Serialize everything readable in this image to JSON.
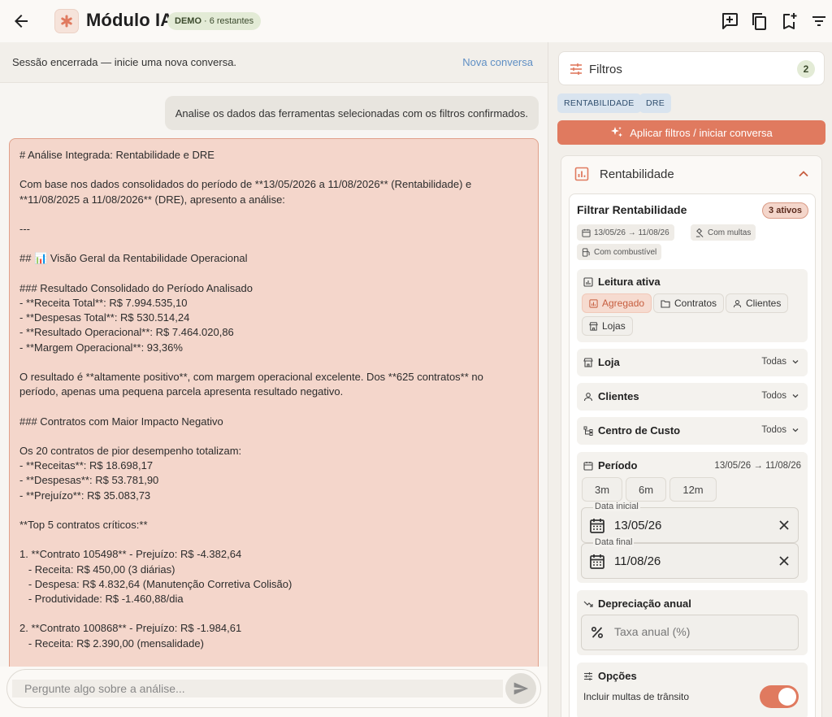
{
  "header": {
    "title": "Módulo IA",
    "badge_demo": "DEMO",
    "badge_rest": "· 6 restantes",
    "icons": [
      "back-arrow-icon",
      "asterisk-logo-icon",
      "add-comment-icon",
      "copy-icon",
      "bookmark-add-icon",
      "filter-list-icon"
    ]
  },
  "session": {
    "text": "Sessão encerrada — inicie uma nova conversa.",
    "new_conversation": "Nova conversa"
  },
  "chat": {
    "user_message": "Analise os dados das ferramentas selecionadas com os filtros confirmados.",
    "ai_lines": [
      "# Análise Integrada: Rentabilidade e DRE",
      "",
      "Com base nos dados consolidados do período de **13/05/2026 a 11/08/2026** (Rentabilidade) e",
      "**11/08/2025 a 11/08/2026** (DRE), apresento a análise:",
      "",
      "---",
      "",
      "## 📊 Visão Geral da Rentabilidade Operacional",
      "",
      "### Resultado Consolidado do Período Analisado",
      "- **Receita Total**: R$ 7.994.535,10",
      "- **Despesas Total**: R$ 530.514,24",
      "- **Resultado Operacional**: R$ 7.464.020,86",
      "- **Margem Operacional**: 93,36%",
      "",
      "O resultado é **altamente positivo**, com margem operacional excelente. Dos **625 contratos** no",
      "período, apenas uma pequena parcela apresenta resultado negativo.",
      "",
      "### Contratos com Maior Impacto Negativo",
      "",
      "Os 20 contratos de pior desempenho totalizam:",
      "- **Receitas**: R$ 18.698,17",
      "- **Despesas**: R$ 53.781,90",
      "- **Prejuízo**: R$ 35.083,73",
      "",
      "**Top 5 contratos críticos:**",
      "",
      "1. **Contrato 105498** - Prejuízo: R$ -4.382,64",
      "   - Receita: R$ 450,00 (3 diárias)",
      "   - Despesa: R$ 4.832,64 (Manutenção Corretiva Colisão)",
      "   - Produtividade: R$ -1.460,88/dia",
      "",
      "2. **Contrato 100868** - Prejuízo: R$ -1.984,61",
      "   - Receita: R$ 2.390,00 (mensalidade)"
    ]
  },
  "composer": {
    "placeholder": "Pergunte algo sobre a análise..."
  },
  "filters": {
    "title": "Filtros",
    "count": "2",
    "tags": [
      "RENTABILIDADE",
      "DRE"
    ],
    "apply_label": "Aplicar filtros / iniciar conversa"
  },
  "rentabilidade": {
    "title": "Rentabilidade",
    "inner_title": "Filtrar Rentabilidade",
    "active_badge": "3 ativos",
    "chips": {
      "period": "13/05/26 → 11/08/26",
      "fines": "Com multas",
      "fuel": "Com combustível"
    },
    "leitura": {
      "label": "Leitura ativa",
      "options": [
        "Agregado",
        "Contratos",
        "Clientes",
        "Lojas"
      ]
    },
    "loja": {
      "label": "Loja",
      "value": "Todas"
    },
    "clientes": {
      "label": "Clientes",
      "value": "Todos"
    },
    "centro": {
      "label": "Centro de Custo",
      "value": "Todos"
    },
    "periodo": {
      "label": "Período",
      "value": "13/05/26 → 11/08/26",
      "ranges": [
        "3m",
        "6m",
        "12m"
      ],
      "start_label": "Data inicial",
      "start_value": "13/05/26",
      "end_label": "Data final",
      "end_value": "11/08/26"
    },
    "depreciacao": {
      "label": "Depreciação anual",
      "placeholder": "Taxa anual (%)"
    },
    "opcoes": {
      "label": "Opções",
      "fines_toggle": "Incluir multas de trânsito"
    }
  },
  "colors": {
    "accent": "#e07a5f",
    "ai_bubble": "#f4d6cb",
    "tag_bg": "#d9e4ef",
    "badge_green": "#e3ebd6"
  }
}
